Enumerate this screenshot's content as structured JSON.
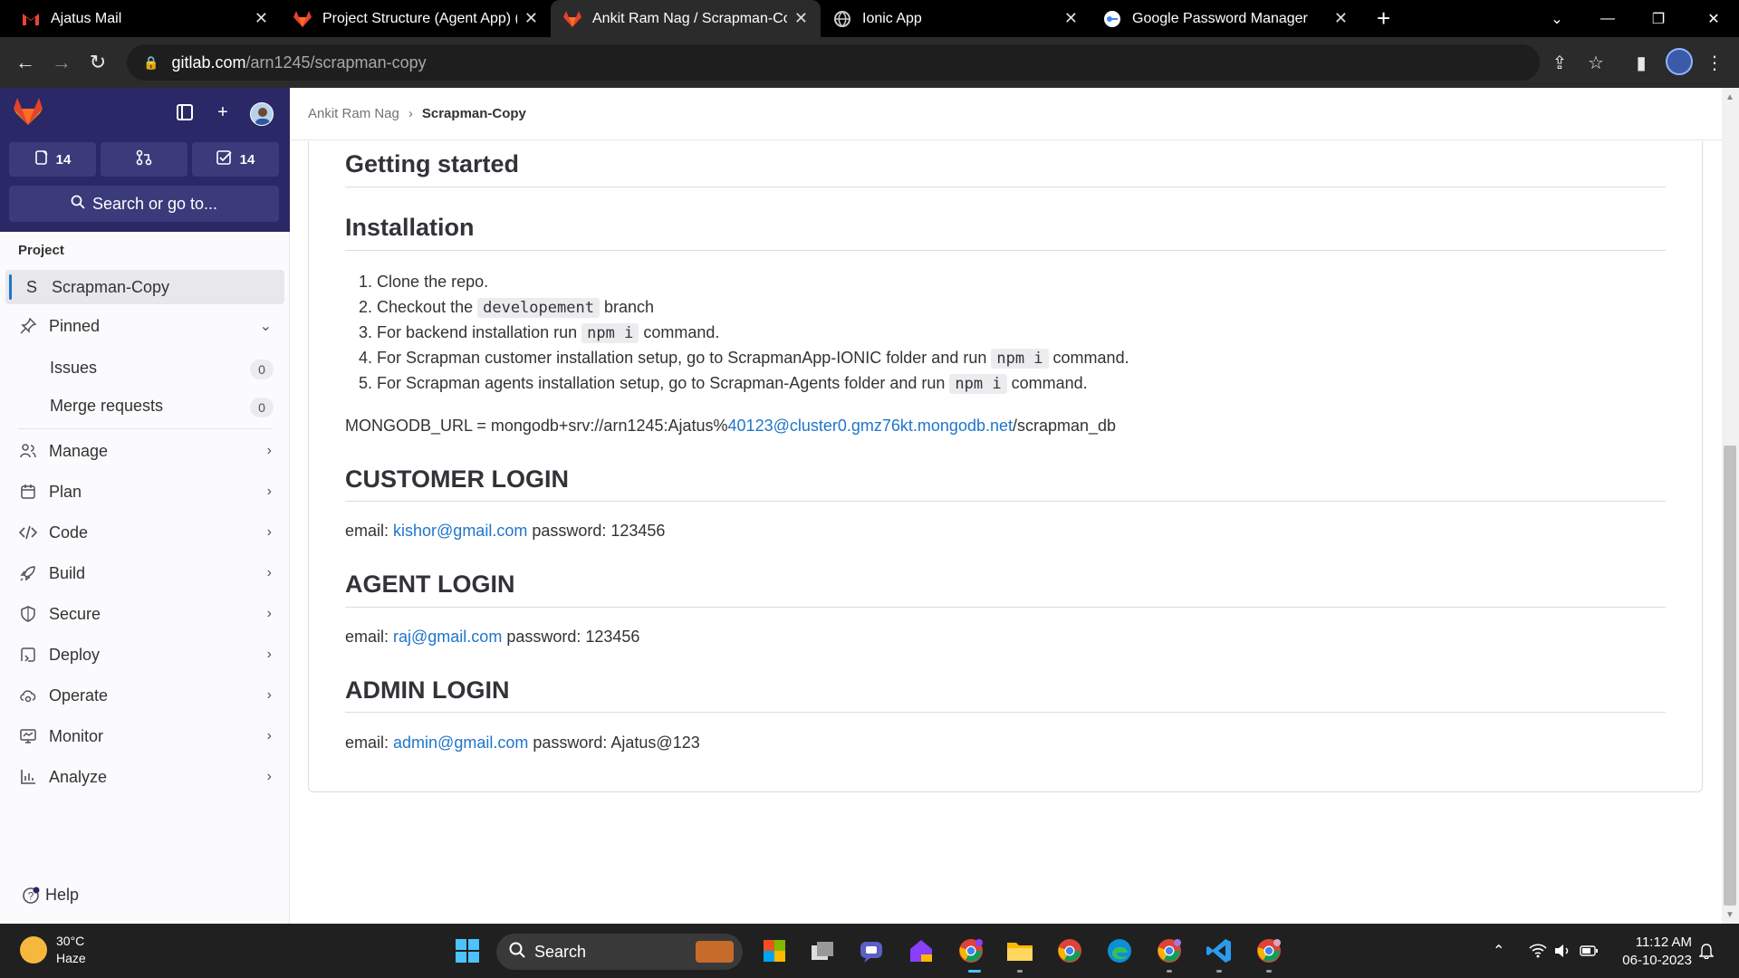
{
  "browser": {
    "tabs": [
      {
        "title": "Ajatus Mail",
        "icon": "gmail-icon"
      },
      {
        "title": "Project Structure (Agent App) (#",
        "icon": "gitlab-icon"
      },
      {
        "title": "Ankit Ram Nag / Scrapman-Cop",
        "icon": "gitlab-icon"
      },
      {
        "title": "Ionic App",
        "icon": "globe-icon"
      },
      {
        "title": "Google Password Manager",
        "icon": "password-manager-icon"
      }
    ],
    "url_host": "gitlab.com",
    "url_path": "/arn1245/scrapman-copy"
  },
  "sidebar": {
    "counts": {
      "issues": "14",
      "todos": "14"
    },
    "search_label": "Search or go to...",
    "section_label": "Project",
    "project": {
      "initial": "S",
      "name": "Scrapman-Copy"
    },
    "pinned_label": "Pinned",
    "pinned_items": [
      {
        "label": "Issues",
        "count": "0"
      },
      {
        "label": "Merge requests",
        "count": "0"
      }
    ],
    "nav": [
      {
        "label": "Manage",
        "icon": "users-icon"
      },
      {
        "label": "Plan",
        "icon": "calendar-icon"
      },
      {
        "label": "Code",
        "icon": "code-icon"
      },
      {
        "label": "Build",
        "icon": "rocket-icon"
      },
      {
        "label": "Secure",
        "icon": "shield-icon"
      },
      {
        "label": "Deploy",
        "icon": "deploy-icon"
      },
      {
        "label": "Operate",
        "icon": "cloud-gear-icon"
      },
      {
        "label": "Monitor",
        "icon": "monitor-icon"
      },
      {
        "label": "Analyze",
        "icon": "chart-icon"
      }
    ],
    "help_label": "Help"
  },
  "breadcrumb": {
    "parent": "Ankit Ram Nag",
    "current": "Scrapman-Copy"
  },
  "readme": {
    "getting_started": "Getting started",
    "installation": "Installation",
    "steps": [
      {
        "num": "1.",
        "pre": "Clone the repo.",
        "code": "",
        "post": ""
      },
      {
        "num": "2.",
        "pre": "Checkout the ",
        "code": "developement",
        "post": " branch"
      },
      {
        "num": "3.",
        "pre": "For backend installation run ",
        "code": "npm i",
        "post": " command."
      },
      {
        "num": "4.",
        "pre": "For Scrapman customer installation setup, go to ScrapmanApp-IONIC folder and run ",
        "code": "npm i",
        "post": " command."
      },
      {
        "num": "5.",
        "pre": "For Scrapman agents installation setup, go to Scrapman-Agents folder and run ",
        "code": "npm i",
        "post": " command."
      }
    ],
    "mongo": {
      "pre": "MONGODB_URL = mongodb+srv://arn1245:Ajatus%",
      "link": "40123@cluster0.gmz76kt.mongodb.net",
      "post": "/scrapman_db"
    },
    "customer": {
      "heading": "CUSTOMER LOGIN",
      "label": "email: ",
      "email": "kishor@gmail.com",
      "password": " password: 123456"
    },
    "agent": {
      "heading": "AGENT LOGIN",
      "label": "email: ",
      "email": "raj@gmail.com",
      "password": " password: 123456"
    },
    "admin": {
      "heading": "ADMIN LOGIN",
      "label": "email: ",
      "email": "admin@gmail.com",
      "password": " password: Ajatus@123"
    }
  },
  "taskbar": {
    "weather_temp": "30°C",
    "weather_desc": "Haze",
    "search_label": "Search",
    "time": "11:12 AM",
    "date": "06-10-2023"
  },
  "colors": {
    "gitlab_sidebar_top": "#2a2867",
    "link": "#1f75cb",
    "gitlab_orange": "#e24329"
  }
}
